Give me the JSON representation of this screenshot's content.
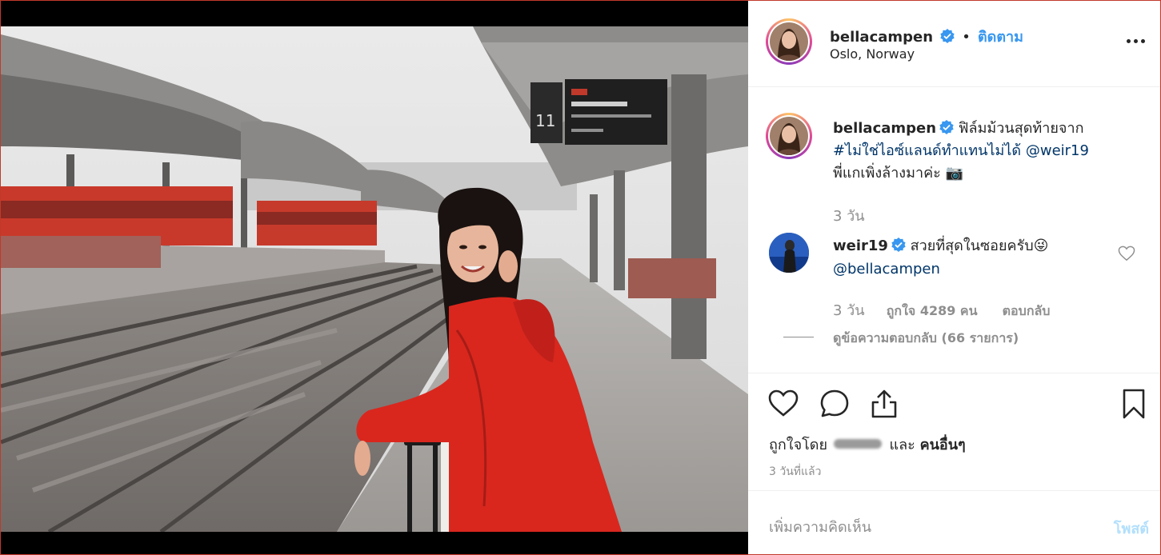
{
  "post": {
    "author": "bellacampen",
    "location": "Oslo, Norway",
    "follow_label": "ติดตาม",
    "separator": "•",
    "caption": {
      "username": "bellacampen",
      "text_before": "ฟิล์มม้วนสุดท้ายจาก",
      "hashtag": "#ไม่ใช่ไอซ์แลนด์ทำแทนไม่ได้",
      "mention": "@weir19",
      "text_after": "พี่แกเพิ่งล้างมาค่ะ 📷",
      "time": "3 วัน"
    },
    "reply": {
      "username": "weir19",
      "text": "สวยที่สุดในซอยครับ😜",
      "mention": "@bellacampen",
      "time": "3 วัน",
      "likes": "ถูกใจ 4289 คน",
      "reply_label": "ตอบกลับ",
      "view_replies": "ดูข้อความตอบกลับ (66 รายการ)"
    },
    "liked_by": {
      "prefix": "ถูกใจโดย",
      "and": "และ",
      "others": "คนอื่นๆ"
    },
    "posted_time": "3 วันที่แล้ว",
    "comment_placeholder": "เพิ่มความคิดเห็น",
    "post_button": "โพสต์"
  },
  "colors": {
    "accent": "#3897f0",
    "raincoat": "#d9271e",
    "link": "#003569",
    "muted": "#8e8e8e"
  },
  "icons": [
    "verified-badge-icon",
    "more-options-icon",
    "heart-icon",
    "comment-icon",
    "share-icon",
    "bookmark-icon"
  ]
}
